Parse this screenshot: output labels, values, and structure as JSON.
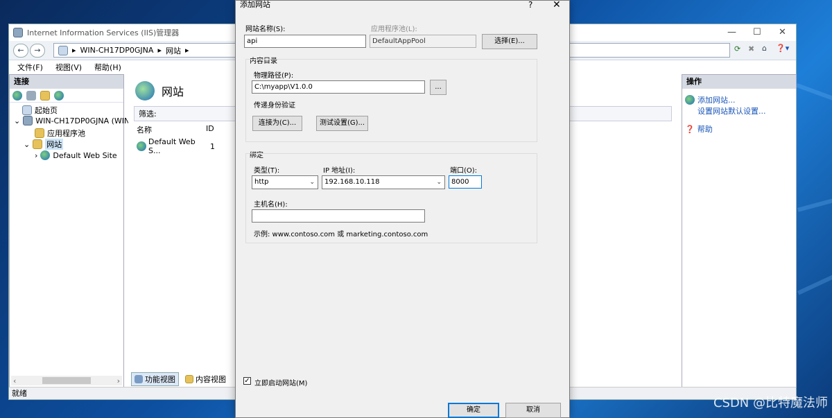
{
  "iis": {
    "title": "Internet Information Services (IIS)管理器",
    "breadcrumb": [
      "WIN-CH17DP0GJNA",
      "网站"
    ],
    "menu": [
      "文件(F)",
      "视图(V)",
      "帮助(H)"
    ],
    "connections_header": "连接",
    "tree": {
      "start_page": "起始页",
      "server": "WIN-CH17DP0GJNA (WIN-",
      "app_pools": "应用程序池",
      "sites": "网站",
      "default_site": "Default Web Site"
    },
    "center": {
      "title": "网站",
      "filter_label": "筛选:",
      "col_name": "名称",
      "col_id": "ID",
      "row_name": "Default Web S...",
      "row_id": "1",
      "tab_features": "功能视图",
      "tab_content": "内容视图"
    },
    "actions": {
      "header": "操作",
      "add_site": "添加网站...",
      "set_defaults": "设置网站默认设置...",
      "help": "帮助"
    },
    "status": "就绪"
  },
  "dialog": {
    "title": "添加网站",
    "help_glyph": "?",
    "site_name_label": "网站名称(S):",
    "site_name_value": "api",
    "app_pool_label": "应用程序池(L):",
    "app_pool_value": "DefaultAppPool",
    "select_button": "选择(E)...",
    "content_dir_label": "内容目录",
    "physical_path_label": "物理路径(P):",
    "physical_path_value": "C:\\myapp\\V1.0.0",
    "browse_button": "...",
    "pass_through_label": "传递身份验证",
    "connect_as_button": "连接为(C)...",
    "test_settings_button": "测试设置(G)...",
    "binding_label": "绑定",
    "type_label": "类型(T):",
    "type_value": "http",
    "ip_label": "IP 地址(I):",
    "ip_value": "192.168.10.118",
    "port_label": "端口(O):",
    "port_value": "8000",
    "host_label": "主机名(H):",
    "host_value": "",
    "example_text": "示例: www.contoso.com 或 marketing.contoso.com",
    "start_now_label": "立即启动网站(M)",
    "start_now_checked": true,
    "ok_button": "确定",
    "cancel_button": "取消"
  },
  "watermark": "CSDN @比特魔法师"
}
